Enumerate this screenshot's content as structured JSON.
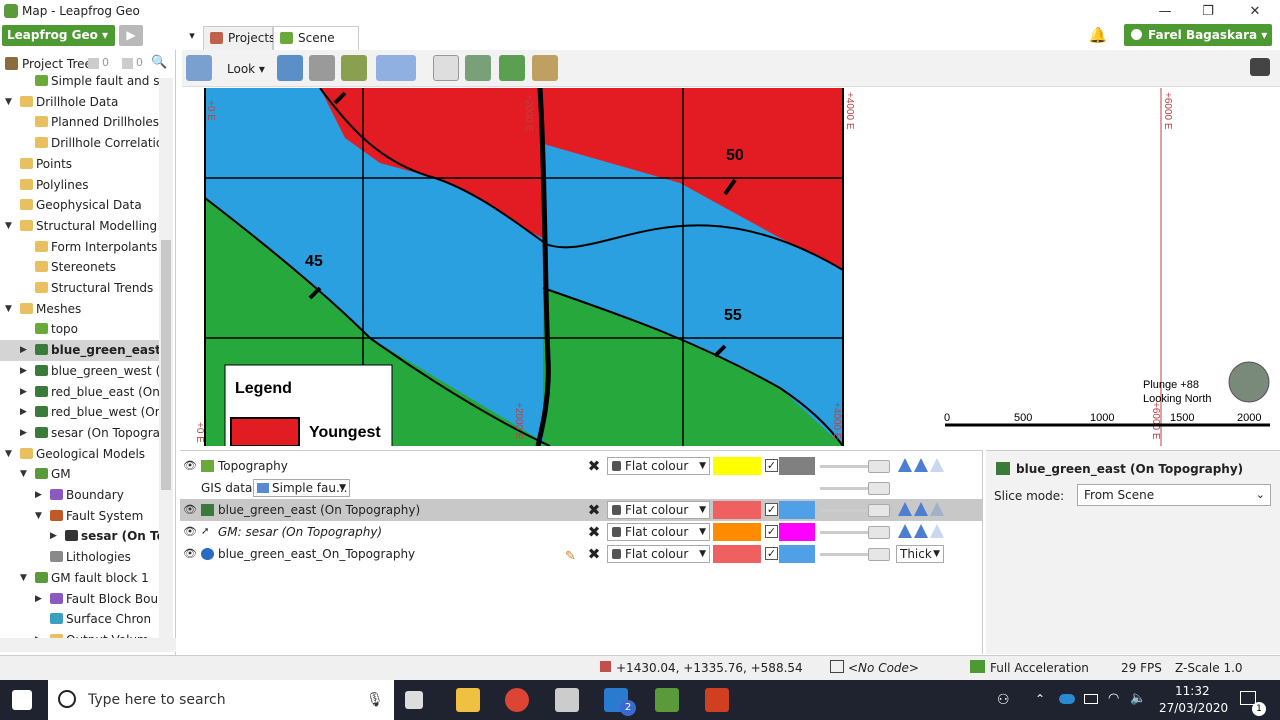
{
  "window": {
    "title": "Map - Leapfrog Geo",
    "minimize": "—",
    "restore": "❐",
    "close": "✕"
  },
  "header": {
    "app_button": "Leapfrog Geo ▾",
    "play": "▶",
    "tabs": [
      {
        "label": "Projects"
      },
      {
        "label": "Scene View"
      }
    ],
    "user": "Farel Bagaskara ▾"
  },
  "toolbar": {
    "look_label": "Look ▾"
  },
  "project_tree": {
    "title": "Project Tree",
    "counter_a": "0",
    "counter_b": "0",
    "items": [
      {
        "label": "Simple fault and sed",
        "indent": 2
      },
      {
        "label": "Drillhole Data",
        "indent": 1,
        "arrow": "▼"
      },
      {
        "label": "Planned Drillholes",
        "indent": 2
      },
      {
        "label": "Drillhole Correlation",
        "indent": 2
      },
      {
        "label": "Points",
        "indent": 1
      },
      {
        "label": "Polylines",
        "indent": 1
      },
      {
        "label": "Geophysical Data",
        "indent": 1
      },
      {
        "label": "Structural Modelling",
        "indent": 1,
        "arrow": "▼"
      },
      {
        "label": "Form Interpolants",
        "indent": 2
      },
      {
        "label": "Stereonets",
        "indent": 2
      },
      {
        "label": "Structural Trends",
        "indent": 2
      },
      {
        "label": "Meshes",
        "indent": 1,
        "arrow": "▼"
      },
      {
        "label": "topo",
        "indent": 2
      },
      {
        "label": "blue_green_east (O",
        "indent": 2,
        "arrow": "▶",
        "bold": true,
        "selected": true
      },
      {
        "label": "blue_green_west (Or",
        "indent": 2,
        "arrow": "▶"
      },
      {
        "label": "red_blue_east (On To",
        "indent": 2,
        "arrow": "▶"
      },
      {
        "label": "red_blue_west (On T",
        "indent": 2,
        "arrow": "▶"
      },
      {
        "label": "sesar (On Topograpl",
        "indent": 2,
        "arrow": "▶"
      },
      {
        "label": "Geological Models",
        "indent": 1,
        "arrow": "▼"
      },
      {
        "label": "GM",
        "indent": 2,
        "arrow": "▼"
      },
      {
        "label": "Boundary",
        "indent": 3,
        "arrow": "▶"
      },
      {
        "label": "Fault System",
        "indent": 3,
        "arrow": "▼"
      },
      {
        "label": "sesar (On Top",
        "indent": 4,
        "arrow": "▶",
        "bold": true
      },
      {
        "label": "Lithologies",
        "indent": 3
      },
      {
        "label": "GM fault block 1",
        "indent": 2,
        "arrow": "▼"
      },
      {
        "label": "Fault Block Bou",
        "indent": 3,
        "arrow": "▶"
      },
      {
        "label": "Surface Chron",
        "indent": 3
      },
      {
        "label": "Output Volum",
        "indent": 3,
        "arrow": "▶"
      }
    ]
  },
  "scene": {
    "grid_labels": [
      "+0 E",
      "+2000 E",
      "+4000 E",
      "+6000 E",
      "+0 E",
      "+2000 E",
      "+4000 E",
      "+6000 E"
    ],
    "dip_labels": [
      "50",
      "45",
      "55"
    ],
    "legend_title": "Legend",
    "legend_item": "Youngest",
    "plunge": "Plunge +88",
    "looking": "Looking North",
    "scale_ticks": [
      "0",
      "500",
      "1000",
      "1500",
      "2000"
    ]
  },
  "layers": [
    {
      "name": "Topography",
      "mode": "Flat colour",
      "c1": "#ffff00",
      "c2": "#808080"
    },
    {
      "gis_label": "GIS data:",
      "gis_value": "Simple fau..."
    },
    {
      "name": "blue_green_east (On Topography)",
      "mode": "Flat colour",
      "c1": "#f06060",
      "c2": "#4fa0e6"
    },
    {
      "name": "GM: sesar (On Topography)",
      "mode": "Flat colour",
      "c1": "#ff8c00",
      "c2": "#ff00ff"
    },
    {
      "name": "blue_green_east_On_Topography",
      "mode": "Flat colour",
      "c1": "#f06060",
      "c2": "#4fa0e6",
      "extra": "Thick"
    }
  ],
  "properties": {
    "title": "blue_green_east (On Topography)",
    "slice_label": "Slice mode:",
    "slice_value": "From Scene"
  },
  "status": {
    "coords": "+1430.04, +1335.76, +588.54",
    "code": "<No Code>",
    "accel": "Full Acceleration",
    "fps": "29 FPS",
    "zscale": "Z-Scale 1.0"
  },
  "taskbar": {
    "search": "Type here to search",
    "time": "11:32",
    "date": "27/03/2020",
    "mail_badge": "2",
    "notif_badge": "1"
  }
}
